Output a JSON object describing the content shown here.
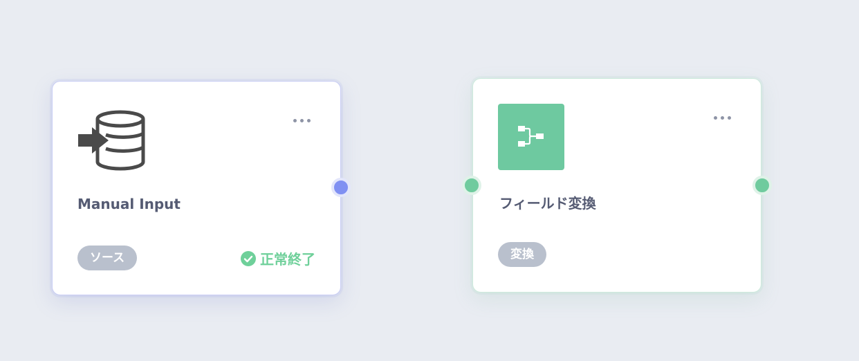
{
  "nodes": [
    {
      "id_label": "source",
      "title": "Manual Input",
      "tag": "ソース",
      "status": "正常終了",
      "icon": "database-import-icon",
      "accent": "#8090f2",
      "status_color": "#6fd09a"
    },
    {
      "id_label": "transform",
      "title": "フィールド変換",
      "tag": "変換",
      "icon": "flow-split-icon",
      "accent": "#6ec9a0"
    }
  ],
  "colors": {
    "background": "#e9ecf2",
    "card": "#ffffff",
    "tag_bg": "#b9c0cd",
    "title_text": "#555b73",
    "menu_dots": "#8e94a6"
  }
}
